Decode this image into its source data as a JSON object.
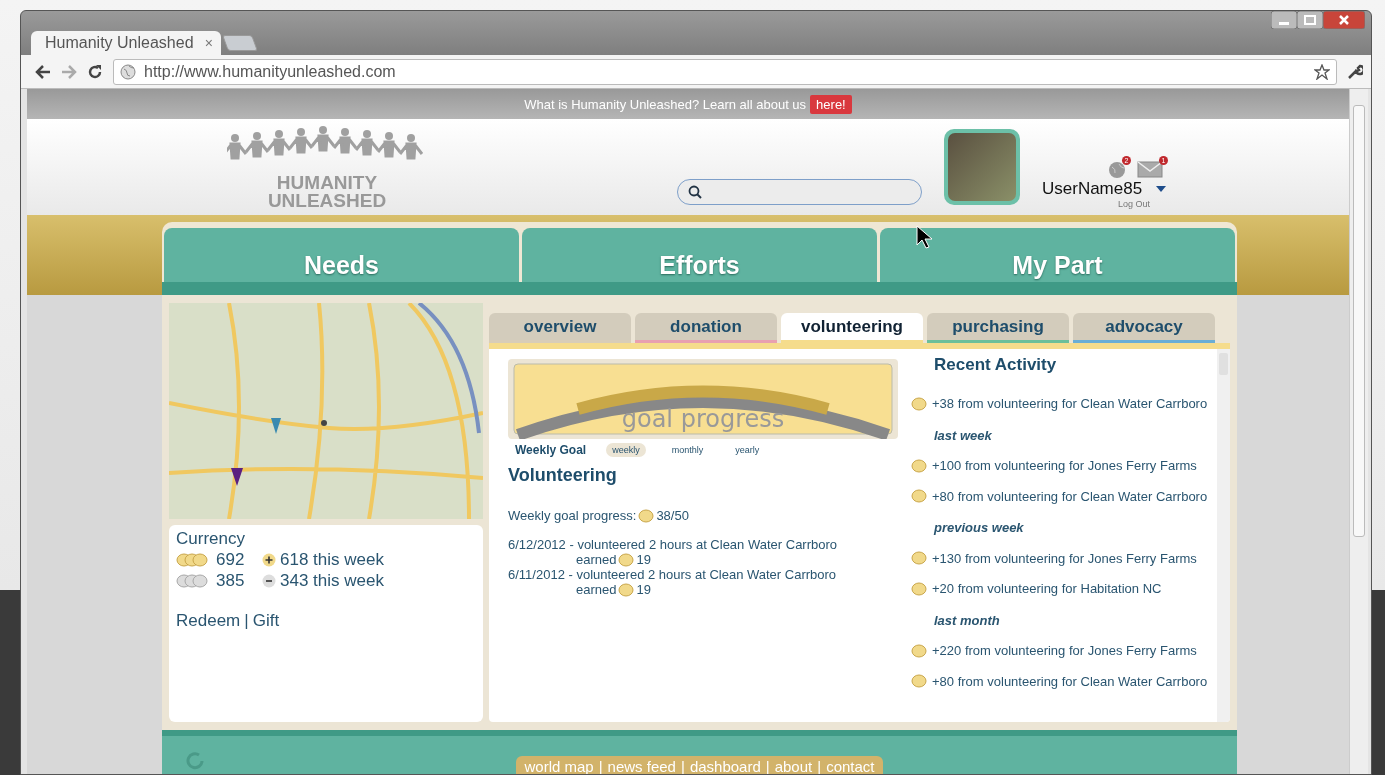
{
  "browser": {
    "tab_title": "Humanity Unleashed",
    "tab_close": "×",
    "url": "http://www.humanityunleashed.com"
  },
  "banner": {
    "text": "What is Humanity Unleashed? Learn all about us",
    "link": "here!"
  },
  "header": {
    "logo_lines": [
      "HUMANITY",
      "UNLEASHED"
    ],
    "user": {
      "name": "UserName85",
      "logout": "Log Out",
      "notifications": "2",
      "messages": "1"
    }
  },
  "main_tabs": [
    {
      "label": "Needs"
    },
    {
      "label": "Efforts"
    },
    {
      "label": "My Part"
    }
  ],
  "currency": {
    "title": "Currency",
    "rows": [
      {
        "kind": "gain",
        "amount": "692",
        "change": "618 this week"
      },
      {
        "kind": "loss",
        "amount": "385",
        "change": "343 this week"
      }
    ],
    "links": [
      "Redeem",
      "Gift"
    ],
    "separator": "|"
  },
  "sub_tabs": [
    {
      "label": "overview",
      "selected": false,
      "color": "#d8cdb8"
    },
    {
      "label": "donation",
      "selected": false,
      "color": "#e8a0b0"
    },
    {
      "label": "volunteering",
      "selected": true,
      "color": "#f5dc8c"
    },
    {
      "label": "purchasing",
      "selected": false,
      "color": "#6cbf9a"
    },
    {
      "label": "advocacy",
      "selected": false,
      "color": "#6aaed6"
    }
  ],
  "goal": {
    "caption": "goal progress",
    "period_label": "Weekly Goal",
    "periods": [
      {
        "label": "weekly",
        "selected": true
      },
      {
        "label": "monthly",
        "selected": false
      },
      {
        "label": "yearly",
        "selected": false
      }
    ]
  },
  "volunteering": {
    "title": "Volunteering",
    "progress_label": "Weekly goal progress:",
    "progress_value": "38/50",
    "entries": [
      {
        "line": "6/12/2012 - volunteered 2 hours at Clean Water Carrboro",
        "earned_label": "earned",
        "earned": "19"
      },
      {
        "line": "6/11/2012 - volunteered 2 hours at Clean Water Carrboro",
        "earned_label": "earned",
        "earned": "19"
      }
    ]
  },
  "recent": {
    "title": "Recent Activity",
    "items": [
      {
        "kind": "entry",
        "text": "+38 from volunteering for Clean Water Carrboro"
      },
      {
        "kind": "heading",
        "text": "last week"
      },
      {
        "kind": "entry",
        "text": "+100 from volunteering for Jones Ferry Farms"
      },
      {
        "kind": "entry",
        "text": "+80 from volunteering for Clean Water Carrboro"
      },
      {
        "kind": "heading",
        "text": "previous week"
      },
      {
        "kind": "entry",
        "text": "+130 from volunteering for Jones Ferry Farms"
      },
      {
        "kind": "entry",
        "text": "+20 from volunteering for Habitation NC"
      },
      {
        "kind": "heading",
        "text": "last month"
      },
      {
        "kind": "entry",
        "text": "+220 from volunteering for Jones Ferry Farms"
      },
      {
        "kind": "entry",
        "text": "+80 from volunteering for Clean Water Carrboro"
      }
    ]
  },
  "footer": {
    "links": [
      "world map",
      "news feed",
      "dashboard",
      "about",
      "contact"
    ],
    "separator": "|"
  }
}
